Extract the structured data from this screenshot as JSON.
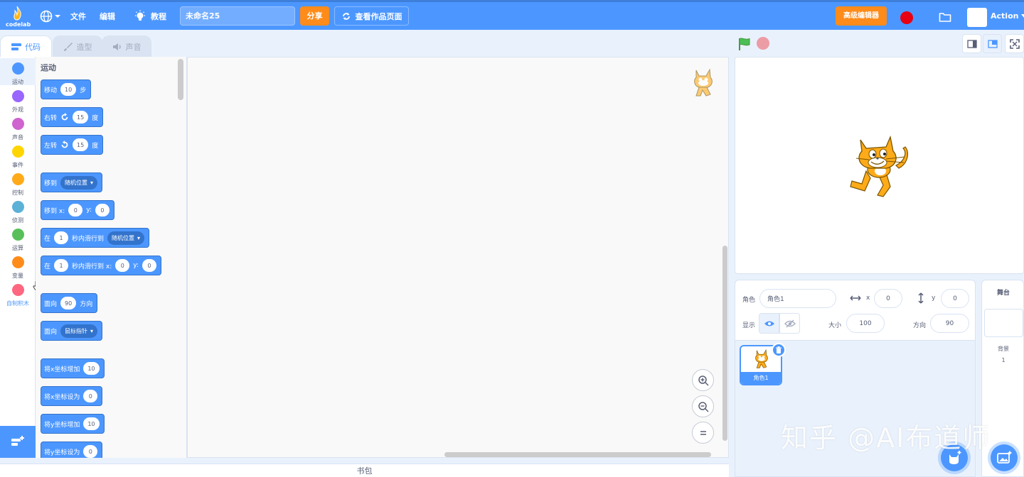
{
  "menubar": {
    "logo_text": "codelab",
    "file": "文件",
    "edit": "编辑",
    "tutorials": "教程",
    "project_title": "未命名25",
    "share": "分享",
    "see_project_page": "查看作品页面",
    "advanced_editor": "高级编辑器",
    "user": "Action"
  },
  "tabs": {
    "code": "代码",
    "costumes": "造型",
    "sounds": "声音"
  },
  "categories": [
    {
      "label": "运动",
      "color": "#4c97ff"
    },
    {
      "label": "外观",
      "color": "#9966ff"
    },
    {
      "label": "声音",
      "color": "#cf63cf"
    },
    {
      "label": "事件",
      "color": "#ffd500"
    },
    {
      "label": "控制",
      "color": "#ffab19"
    },
    {
      "label": "侦测",
      "color": "#5cb1d6"
    },
    {
      "label": "运算",
      "color": "#59c059"
    },
    {
      "label": "变量",
      "color": "#ff8c1a"
    },
    {
      "label": "自制积木",
      "color": "#ff6680"
    }
  ],
  "palette": {
    "heading": "运动",
    "move": {
      "label": "移动",
      "steps": "10",
      "unit": "步"
    },
    "turn_right": {
      "label": "右转",
      "degrees": "15",
      "unit": "度"
    },
    "turn_left": {
      "label": "左转",
      "degrees": "15",
      "unit": "度"
    },
    "go_to": {
      "label": "移到",
      "target": "随机位置"
    },
    "go_to_xy": {
      "label": "移到 x:",
      "x": "0",
      "y_label": "y:",
      "y": "0"
    },
    "glide_to": {
      "label": "在",
      "secs": "1",
      "middle": "秒内滑行到",
      "target": "随机位置"
    },
    "glide_xy": {
      "label": "在",
      "secs": "1",
      "middle": "秒内滑行到 x:",
      "x": "0",
      "y_label": "y:",
      "y": "0"
    },
    "point_dir": {
      "label": "面向",
      "dir": "90",
      "unit": "方向"
    },
    "point_towards": {
      "label": "面向",
      "target": "鼠标指针"
    },
    "change_x": {
      "label": "将x坐标增加",
      "value": "10"
    },
    "set_x": {
      "label": "将x坐标设为",
      "value": "0"
    },
    "change_y": {
      "label": "将y坐标增加",
      "value": "10"
    },
    "set_y": {
      "label": "将y坐标设为",
      "value": "0"
    }
  },
  "backpack": "书包",
  "sprite_info": {
    "sprite_label": "角色",
    "sprite_name": "角色1",
    "x_label": "x",
    "x": "0",
    "y_label": "y",
    "y": "0",
    "show_label": "显示",
    "size_label": "大小",
    "size": "100",
    "direction_label": "方向",
    "direction": "90"
  },
  "sprite_list": [
    {
      "name": "角色1"
    }
  ],
  "stage_panel": {
    "title": "舞台",
    "backdrops_label": "背景",
    "backdrops_count": "1"
  },
  "watermark": "知乎 @AI布道师"
}
